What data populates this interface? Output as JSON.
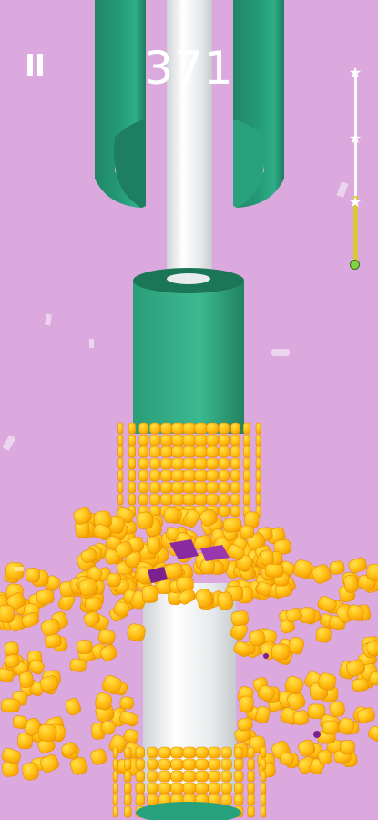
{
  "hud": {
    "score": "371",
    "pause_icon": "pause-icon",
    "star_icon": "star-icon",
    "stars_total": 3,
    "level_progress": 0.35
  },
  "colors": {
    "background": "#dba9dd",
    "pole": "#eef1f2",
    "ring": "#239673",
    "corn": "#ffbc12",
    "progress_fill": "#d9c93a",
    "progress_marker": "#7fd13f"
  }
}
